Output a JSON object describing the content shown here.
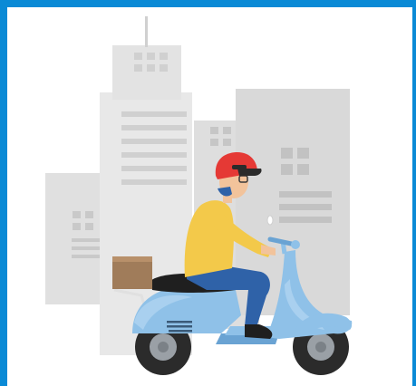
{
  "illustration": {
    "subject": "delivery-scooter-rider",
    "icons": [
      "city-buildings-icon",
      "rider-icon",
      "scooter-icon",
      "parcel-box-icon"
    ]
  },
  "colors": {
    "frame_border": "#0a8ad6",
    "background": "#ffffff",
    "building_light": "#e3e3e3",
    "building_mid": "#d7d7d7",
    "building_dark": "#cfcfcf",
    "window": "#bdbdbd",
    "scooter_body": "#8fc1e8",
    "scooter_shade": "#6aa3d3",
    "helmet": "#e53935",
    "shirt": "#f3c94a",
    "pants": "#2f62a8",
    "box": "#a07c5a",
    "tire": "#2b2b2b",
    "hub": "#9aa0a6",
    "skin": "#f2c39b",
    "seat": "#1f1f1f"
  }
}
